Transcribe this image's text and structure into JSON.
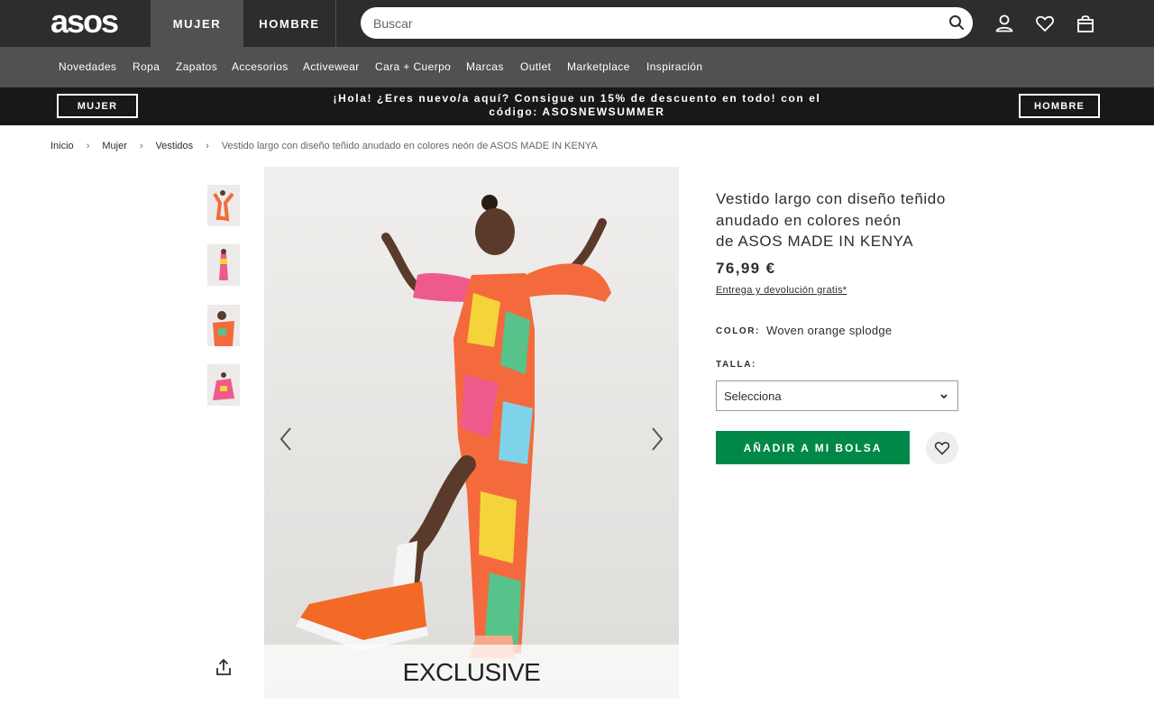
{
  "header": {
    "logo": "asos",
    "gender_tabs": [
      "MUJER",
      "HOMBRE"
    ],
    "search": {
      "placeholder": "Buscar",
      "icon": "search-icon"
    },
    "icons": [
      "account-icon",
      "heart-icon",
      "bag-icon"
    ]
  },
  "categories": [
    "Novedades",
    "Ropa",
    "Zapatos",
    "Accesorios",
    "Activewear",
    "Cara + Cuerpo",
    "Marcas",
    "Outlet",
    "Marketplace",
    "Inspiración"
  ],
  "promo": {
    "left_button": "MUJER",
    "text_line1": "¡Hola! ¿Eres nuevo/a aquí? Consigue un 15% de descuento en todo! con el",
    "text_line2": "código: ASOSNEWSUMMER",
    "right_button": "HOMBRE"
  },
  "breadcrumb": [
    "Inicio",
    "Mujer",
    "Vestidos",
    "Vestido largo con diseño teñido anudado en colores neón de ASOS MADE IN KENYA"
  ],
  "gallery": {
    "thumbnail_count": 4,
    "badge": "EXCLUSIVE",
    "colors": {
      "dress_orange": "#f46a3c",
      "dress_pink": "#ef5a8c",
      "dress_yellow": "#f4d43a",
      "dress_green": "#57c28a",
      "shoe": "#f26a25",
      "skin": "#5a3a2a"
    }
  },
  "product": {
    "title_lines": [
      "Vestido largo con diseño teñido",
      "anudado en colores neón",
      "de ASOS MADE IN KENYA"
    ],
    "price": "76,99 €",
    "delivery": "Entrega y devolución gratis*",
    "color_label": "COLOR:",
    "color_value": "Woven orange splodge",
    "size_label": "TALLA:",
    "size_selected": "Selecciona",
    "add_button": "AÑADIR A MI BOLSA",
    "accent_color": "#018849"
  }
}
